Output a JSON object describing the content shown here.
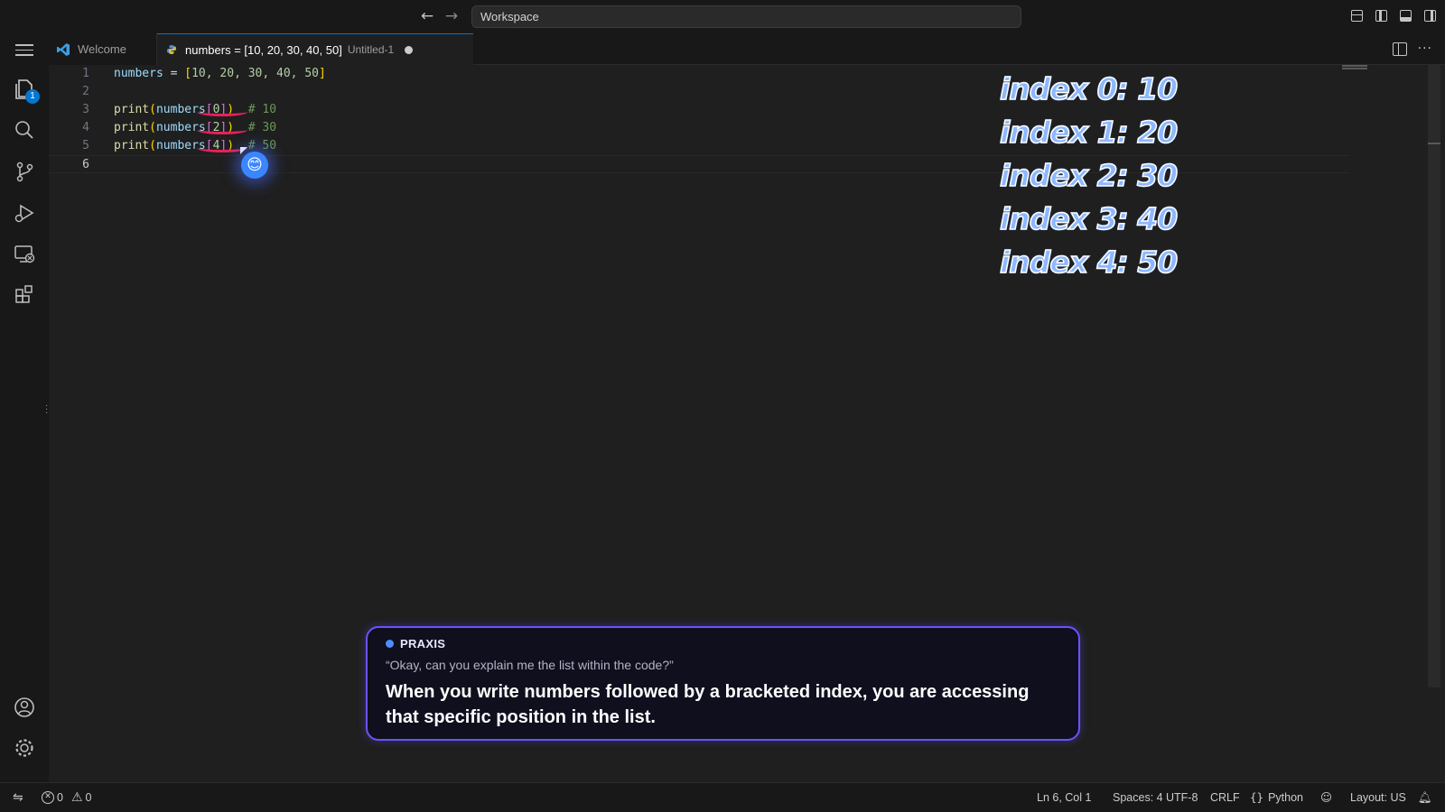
{
  "titlebar": {
    "search_text": "Workspace",
    "back_icon": "arrow-left-icon",
    "forward_icon": "arrow-right-icon"
  },
  "activitybar": {
    "explorer_badge": "1",
    "items": [
      "menu-icon",
      "explorer-icon",
      "search-icon",
      "source-control-icon",
      "run-debug-icon",
      "remote-explorer-icon",
      "extensions-icon",
      "account-icon",
      "settings-icon"
    ]
  },
  "tabs": {
    "welcome_label": "Welcome",
    "active_label": "numbers = [10, 20, 30, 40, 50]",
    "active_desc": "Untitled-1"
  },
  "editor": {
    "line_numbers": [
      "1",
      "2",
      "3",
      "4",
      "5",
      "6"
    ],
    "lines": [
      {
        "var": "numbers",
        "op": " = ",
        "open": "[",
        "items": "10, 20, 30, 40, 50",
        "close": "]"
      },
      {},
      {
        "fn": "print",
        "arg": "numbers",
        "index": "0",
        "comment": "# 10"
      },
      {
        "fn": "print",
        "arg": "numbers",
        "index": "2",
        "comment": "# 30"
      },
      {
        "fn": "print",
        "arg": "numbers",
        "index": "4",
        "comment": "# 50"
      },
      {}
    ],
    "overlay_lines": [
      "index 0: 10",
      "index 1: 20",
      "index 2: 30",
      "index 3: 40",
      "index 4: 50"
    ],
    "annotation_emoji": "😊"
  },
  "caption": {
    "speaker": "PRAXIS",
    "question": "“Okay, can you explain me the list within the code?”",
    "answer": "When you write numbers followed by a bracketed index, you are accessing that specific position in the list."
  },
  "statusbar": {
    "errors": "0",
    "warnings": "0",
    "position": "Ln 6, Col 1",
    "spaces": "Spaces: 4",
    "encoding": "UTF-8",
    "eol": "CRLF",
    "language": "Python",
    "layout": "Layout: US"
  },
  "colors": {
    "accent": "#0078d4",
    "annotation_underline": "#e8225c",
    "caption_border": "#6a52ff",
    "overlay_text": "#8db8ff"
  }
}
